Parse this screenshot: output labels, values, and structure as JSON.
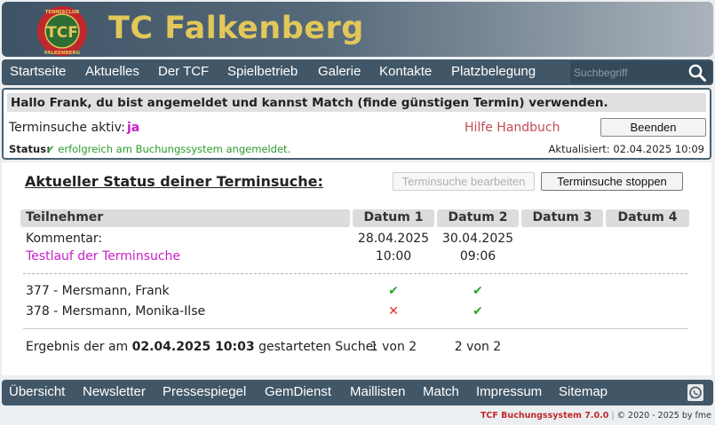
{
  "header": {
    "site_title": "TC Falkenberg",
    "logo_text": "TENNISCLUB FALKENBERG",
    "logo_initials": "TCF",
    "colors": {
      "logo_ring": "#c0282d",
      "logo_green": "#2e6e35",
      "title": "#e2c75a"
    }
  },
  "nav": {
    "items": [
      {
        "label": "Startseite"
      },
      {
        "label": "Aktuelles"
      },
      {
        "label": "Der TCF"
      },
      {
        "label": "Spielbetrieb"
      },
      {
        "label": "Galerie"
      },
      {
        "label": "Kontakte"
      },
      {
        "label": "Platzbelegung"
      }
    ],
    "search_placeholder": "Suchbegriff",
    "search_icon": "search-icon"
  },
  "status_panel": {
    "greeting": "Hallo Frank, du bist angemeldet und kannst Match (finde günstigen Termin) verwenden.",
    "search_active_label": "Terminsuche aktiv:",
    "search_active_value": "ja",
    "help_link": "Hilfe Handbuch",
    "end_button": "Beenden",
    "status_label": "Status:",
    "status_message": "✔ erfolgreich am Buchungssystem angemeldet.",
    "updated_label": "Aktualisiert:",
    "updated_value": "02.04.2025 10:09"
  },
  "main": {
    "title": "Aktueller Status deiner Terminsuche:",
    "edit_button": "Terminsuche bearbeiten",
    "stop_button": "Terminsuche stoppen",
    "table": {
      "headers": [
        "Teilnehmer",
        "Datum 1",
        "Datum 2",
        "Datum 3",
        "Datum 4"
      ],
      "comment_label": "Kommentar:",
      "comment_text": "Testlauf der Terminsuche",
      "dates": [
        {
          "date": "28.04.2025",
          "time": "10:00"
        },
        {
          "date": "30.04.2025",
          "time": "09:06"
        }
      ],
      "participants": [
        {
          "name": "377 - Mersmann, Frank",
          "d1": "✔",
          "d2": "✔"
        },
        {
          "name": "378 - Mersmann, Monika-Ilse",
          "d1": "✕",
          "d2": "✔"
        }
      ],
      "result_prefix": "Ergebnis der am ",
      "result_datetime": "02.04.2025 10:03",
      "result_suffix": " gestarteten Suche:",
      "result_d1": "1 von 2",
      "result_d2": "2 von 2"
    }
  },
  "footer": {
    "items": [
      {
        "label": "Übersicht"
      },
      {
        "label": "Newsletter"
      },
      {
        "label": "Pressespiegel"
      },
      {
        "label": "GemDienst"
      },
      {
        "label": "Maillisten"
      },
      {
        "label": "Match"
      },
      {
        "label": "Impressum"
      },
      {
        "label": "Sitemap"
      }
    ],
    "whatsapp_icon": "whatsapp-icon"
  },
  "credits": {
    "brand": "TCF Buchungssystem 7.0.0",
    "copyright": "© 2020 - 2025 by fme"
  }
}
